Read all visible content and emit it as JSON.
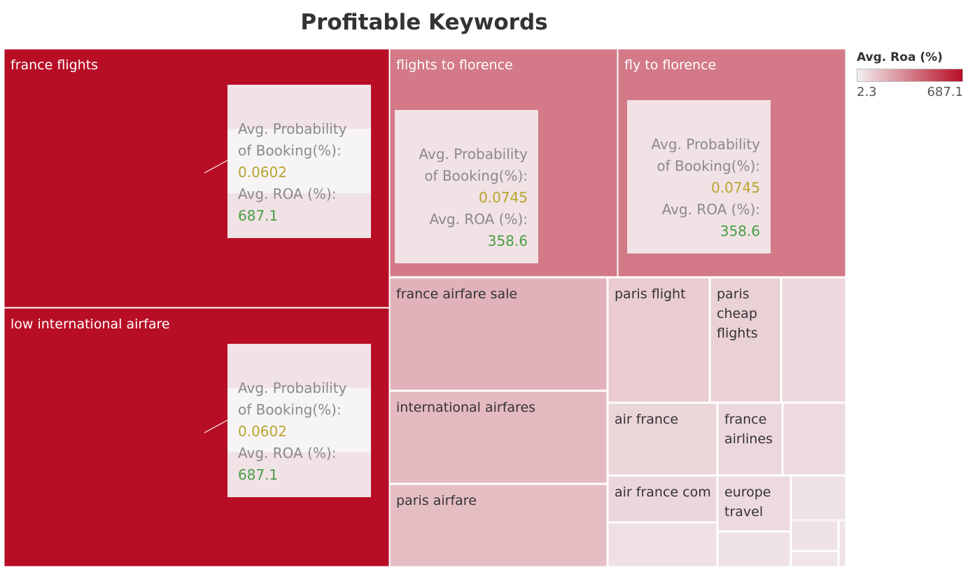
{
  "chart_data": {
    "type": "treemap",
    "title": "Profitable Keywords",
    "color_legend": {
      "title": "Avg. Roa (%)",
      "min_label": "2.3",
      "max_label": "687.1",
      "min": 2.3,
      "max": 687.1,
      "color_low": "#f2eef0",
      "color_high": "#b70e26"
    },
    "tooltip_labels": {
      "probability": [
        "Avg. Probability",
        "of Booking(%):"
      ],
      "roa": "Avg. ROA (%):"
    },
    "colors": {
      "probability_value": "#b8a52e",
      "roa_value": "#4a9e45",
      "tooltip_text": "#8a8a8a"
    },
    "items": [
      {
        "label": "france flights",
        "roa": 687.1,
        "probability": "0.0602",
        "roa_text": "687.1"
      },
      {
        "label": "low international airfare",
        "roa": 687.1,
        "probability": "0.0602",
        "roa_text": "687.1"
      },
      {
        "label": "flights to florence",
        "roa": 358.6,
        "probability": "0.0745",
        "roa_text": "358.6"
      },
      {
        "label": "fly to florence",
        "roa": 358.6,
        "probability": "0.0745",
        "roa_text": "358.6"
      },
      {
        "label": "france airfare sale",
        "roa": 187
      },
      {
        "label": "international airfares",
        "roa": 165
      },
      {
        "label": "paris airfare",
        "roa": 150
      },
      {
        "label": "paris flight",
        "roa": 110
      },
      {
        "label": "paris cheap flights",
        "roa": 90
      },
      {
        "label": "",
        "roa": 70
      },
      {
        "label": "air france",
        "roa": 80
      },
      {
        "label": "france airlines",
        "roa": 70
      },
      {
        "label": "",
        "roa": 60
      },
      {
        "label": "air france com",
        "roa": 75
      },
      {
        "label": "europe travel",
        "roa": 62
      },
      {
        "label": "",
        "roa": 40
      },
      {
        "label": "",
        "roa": 45
      },
      {
        "label": "",
        "roa": 40
      },
      {
        "label": "",
        "roa": 40
      },
      {
        "label": "",
        "roa": 35
      },
      {
        "label": "",
        "roa": 30
      },
      {
        "label": "",
        "roa": 30
      }
    ]
  }
}
